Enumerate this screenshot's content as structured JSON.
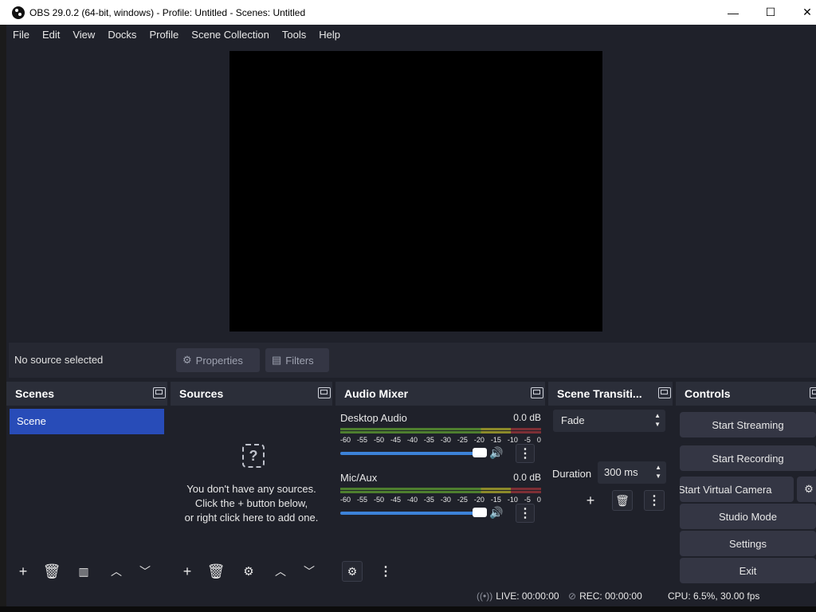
{
  "window": {
    "title": "OBS 29.0.2 (64-bit, windows) - Profile: Untitled - Scenes: Untitled",
    "minimize": "—",
    "maximize": "☐",
    "close": "✕"
  },
  "menu": [
    "File",
    "Edit",
    "View",
    "Docks",
    "Profile",
    "Scene Collection",
    "Tools",
    "Help"
  ],
  "context_bar": {
    "no_source": "No source selected",
    "properties": "Properties",
    "filters": "Filters"
  },
  "docks": {
    "scenes": {
      "title": "Scenes",
      "items": [
        "Scene"
      ]
    },
    "sources": {
      "title": "Sources",
      "empty_line1": "You don't have any sources.",
      "empty_line2": "Click the + button below,",
      "empty_line3": "or right click here to add one."
    },
    "audio_mixer": {
      "title": "Audio Mixer",
      "tracks": [
        {
          "name": "Desktop Audio",
          "level": "0.0 dB",
          "volume": 1.0
        },
        {
          "name": "Mic/Aux",
          "level": "0.0 dB",
          "volume": 1.0
        }
      ],
      "scale": [
        "-60",
        "-55",
        "-50",
        "-45",
        "-40",
        "-35",
        "-30",
        "-25",
        "-20",
        "-15",
        "-10",
        "-5",
        "0"
      ]
    },
    "transitions": {
      "title": "Scene Transiti...",
      "selected": "Fade",
      "duration_label": "Duration",
      "duration_value": "300 ms"
    },
    "controls": {
      "title": "Controls",
      "start_streaming": "Start Streaming",
      "start_recording": "Start Recording",
      "start_virtual_camera": "Start Virtual Camera",
      "studio_mode": "Studio Mode",
      "settings": "Settings",
      "exit": "Exit"
    }
  },
  "status": {
    "live": "LIVE: 00:00:00",
    "rec": "REC: 00:00:00",
    "cpu": "CPU: 6.5%, 30.00 fps"
  },
  "colors": {
    "background": "#1f212a",
    "dock": "#262832",
    "selected_scene": "#284cb8",
    "slider": "#3c82d8"
  }
}
